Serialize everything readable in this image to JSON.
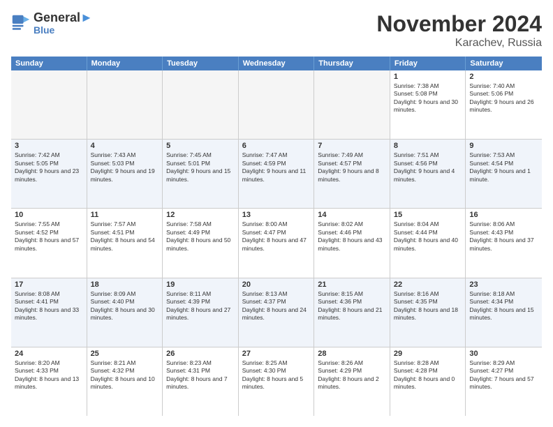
{
  "header": {
    "logo_line1": "General",
    "logo_line2": "Blue",
    "month": "November 2024",
    "location": "Karachev, Russia"
  },
  "weekdays": [
    "Sunday",
    "Monday",
    "Tuesday",
    "Wednesday",
    "Thursday",
    "Friday",
    "Saturday"
  ],
  "rows": [
    {
      "alt": false,
      "cells": [
        {
          "day": "",
          "info": ""
        },
        {
          "day": "",
          "info": ""
        },
        {
          "day": "",
          "info": ""
        },
        {
          "day": "",
          "info": ""
        },
        {
          "day": "",
          "info": ""
        },
        {
          "day": "1",
          "info": "Sunrise: 7:38 AM\nSunset: 5:08 PM\nDaylight: 9 hours and 30 minutes."
        },
        {
          "day": "2",
          "info": "Sunrise: 7:40 AM\nSunset: 5:06 PM\nDaylight: 9 hours and 26 minutes."
        }
      ]
    },
    {
      "alt": true,
      "cells": [
        {
          "day": "3",
          "info": "Sunrise: 7:42 AM\nSunset: 5:05 PM\nDaylight: 9 hours and 23 minutes."
        },
        {
          "day": "4",
          "info": "Sunrise: 7:43 AM\nSunset: 5:03 PM\nDaylight: 9 hours and 19 minutes."
        },
        {
          "day": "5",
          "info": "Sunrise: 7:45 AM\nSunset: 5:01 PM\nDaylight: 9 hours and 15 minutes."
        },
        {
          "day": "6",
          "info": "Sunrise: 7:47 AM\nSunset: 4:59 PM\nDaylight: 9 hours and 11 minutes."
        },
        {
          "day": "7",
          "info": "Sunrise: 7:49 AM\nSunset: 4:57 PM\nDaylight: 9 hours and 8 minutes."
        },
        {
          "day": "8",
          "info": "Sunrise: 7:51 AM\nSunset: 4:56 PM\nDaylight: 9 hours and 4 minutes."
        },
        {
          "day": "9",
          "info": "Sunrise: 7:53 AM\nSunset: 4:54 PM\nDaylight: 9 hours and 1 minute."
        }
      ]
    },
    {
      "alt": false,
      "cells": [
        {
          "day": "10",
          "info": "Sunrise: 7:55 AM\nSunset: 4:52 PM\nDaylight: 8 hours and 57 minutes."
        },
        {
          "day": "11",
          "info": "Sunrise: 7:57 AM\nSunset: 4:51 PM\nDaylight: 8 hours and 54 minutes."
        },
        {
          "day": "12",
          "info": "Sunrise: 7:58 AM\nSunset: 4:49 PM\nDaylight: 8 hours and 50 minutes."
        },
        {
          "day": "13",
          "info": "Sunrise: 8:00 AM\nSunset: 4:47 PM\nDaylight: 8 hours and 47 minutes."
        },
        {
          "day": "14",
          "info": "Sunrise: 8:02 AM\nSunset: 4:46 PM\nDaylight: 8 hours and 43 minutes."
        },
        {
          "day": "15",
          "info": "Sunrise: 8:04 AM\nSunset: 4:44 PM\nDaylight: 8 hours and 40 minutes."
        },
        {
          "day": "16",
          "info": "Sunrise: 8:06 AM\nSunset: 4:43 PM\nDaylight: 8 hours and 37 minutes."
        }
      ]
    },
    {
      "alt": true,
      "cells": [
        {
          "day": "17",
          "info": "Sunrise: 8:08 AM\nSunset: 4:41 PM\nDaylight: 8 hours and 33 minutes."
        },
        {
          "day": "18",
          "info": "Sunrise: 8:09 AM\nSunset: 4:40 PM\nDaylight: 8 hours and 30 minutes."
        },
        {
          "day": "19",
          "info": "Sunrise: 8:11 AM\nSunset: 4:39 PM\nDaylight: 8 hours and 27 minutes."
        },
        {
          "day": "20",
          "info": "Sunrise: 8:13 AM\nSunset: 4:37 PM\nDaylight: 8 hours and 24 minutes."
        },
        {
          "day": "21",
          "info": "Sunrise: 8:15 AM\nSunset: 4:36 PM\nDaylight: 8 hours and 21 minutes."
        },
        {
          "day": "22",
          "info": "Sunrise: 8:16 AM\nSunset: 4:35 PM\nDaylight: 8 hours and 18 minutes."
        },
        {
          "day": "23",
          "info": "Sunrise: 8:18 AM\nSunset: 4:34 PM\nDaylight: 8 hours and 15 minutes."
        }
      ]
    },
    {
      "alt": false,
      "cells": [
        {
          "day": "24",
          "info": "Sunrise: 8:20 AM\nSunset: 4:33 PM\nDaylight: 8 hours and 13 minutes."
        },
        {
          "day": "25",
          "info": "Sunrise: 8:21 AM\nSunset: 4:32 PM\nDaylight: 8 hours and 10 minutes."
        },
        {
          "day": "26",
          "info": "Sunrise: 8:23 AM\nSunset: 4:31 PM\nDaylight: 8 hours and 7 minutes."
        },
        {
          "day": "27",
          "info": "Sunrise: 8:25 AM\nSunset: 4:30 PM\nDaylight: 8 hours and 5 minutes."
        },
        {
          "day": "28",
          "info": "Sunrise: 8:26 AM\nSunset: 4:29 PM\nDaylight: 8 hours and 2 minutes."
        },
        {
          "day": "29",
          "info": "Sunrise: 8:28 AM\nSunset: 4:28 PM\nDaylight: 8 hours and 0 minutes."
        },
        {
          "day": "30",
          "info": "Sunrise: 8:29 AM\nSunset: 4:27 PM\nDaylight: 7 hours and 57 minutes."
        }
      ]
    }
  ]
}
